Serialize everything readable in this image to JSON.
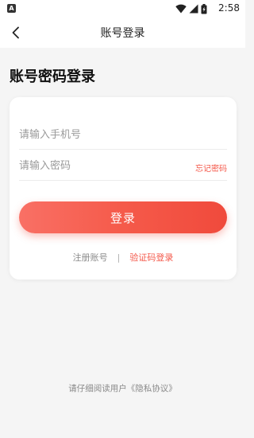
{
  "status_bar": {
    "left_icon": "A",
    "time": "2:58",
    "icons": [
      "wifi-icon",
      "signal-icon",
      "battery-icon"
    ]
  },
  "nav": {
    "title": "账号登录",
    "back_icon": "chevron-left-icon"
  },
  "page": {
    "heading": "账号密码登录"
  },
  "form": {
    "phone_placeholder": "请输入手机号",
    "password_placeholder": "请输入密码",
    "forgot_label": "忘记密码",
    "login_label": "登录",
    "register_label": "注册账号",
    "divider": "|",
    "sms_login_label": "验证码登录"
  },
  "footer": {
    "prefix": "请仔细阅读用户",
    "policy_link": "《隐私协议》"
  },
  "colors": {
    "accent": "#f4584a",
    "background": "#f5f5f5",
    "card": "#ffffff"
  }
}
